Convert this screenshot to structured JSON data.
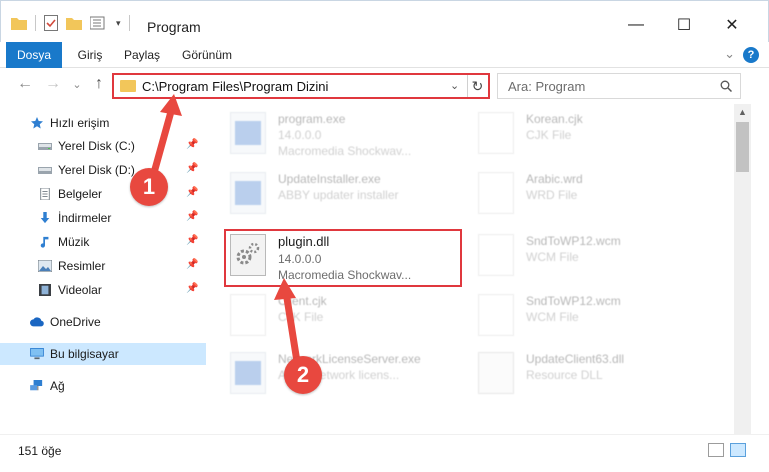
{
  "window": {
    "title": "Program",
    "minimize": "—",
    "maximize": "☐",
    "close": "✕"
  },
  "ribbon": {
    "tabs": [
      "Dosya",
      "Giriş",
      "Paylaş",
      "Görünüm"
    ],
    "chevron": "⌄",
    "help": "?"
  },
  "nav": {
    "back": "←",
    "forward": "→",
    "recent": "⌄",
    "up": "↑",
    "address": "C:\\Program Files\\Program Dizini",
    "dropdown": "⌄",
    "refresh": "↻",
    "search_placeholder": "Ara: Program"
  },
  "sidebar": {
    "items": [
      {
        "label": "Hızlı erişim",
        "icon": "star-icon",
        "pinned": false
      },
      {
        "label": "Yerel Disk (C:)",
        "icon": "drive-icon",
        "pinned": true
      },
      {
        "label": "Yerel Disk (D:)",
        "icon": "drive-icon",
        "pinned": true
      },
      {
        "label": "Belgeler",
        "icon": "documents-icon",
        "pinned": true
      },
      {
        "label": "İndirmeler",
        "icon": "download-icon",
        "pinned": true
      },
      {
        "label": "Müzik",
        "icon": "music-icon",
        "pinned": true
      },
      {
        "label": "Resimler",
        "icon": "pictures-icon",
        "pinned": true
      },
      {
        "label": "Videolar",
        "icon": "videos-icon",
        "pinned": true
      },
      {
        "label": "OneDrive",
        "icon": "cloud-icon",
        "pinned": false
      },
      {
        "label": "Bu bilgisayar",
        "icon": "computer-icon",
        "pinned": false
      },
      {
        "label": "Ağ",
        "icon": "network-icon",
        "pinned": false
      }
    ],
    "pin_glyph": "📌"
  },
  "files": {
    "left": [
      {
        "name": "program.exe",
        "line2": "14.0.0.0",
        "line3": "Macromedia Shockwav..."
      },
      {
        "name": "UpdateInstaller.exe",
        "line2": "ABBY updater installer",
        "line3": ""
      },
      {
        "name": "plugin.dll",
        "line2": "14.0.0.0",
        "line3": "Macromedia Shockwav..."
      },
      {
        "name": "Client.cjk",
        "line2": "CJK File",
        "line3": ""
      },
      {
        "name": "NetworkLicenseServer.exe",
        "line2": "ABBY network licens...",
        "line3": ""
      }
    ],
    "right": [
      {
        "name": "Korean.cjk",
        "line2": "CJK File"
      },
      {
        "name": "Arabic.wrd",
        "line2": "WRD File"
      },
      {
        "name": "SndToWP12.wcm",
        "line2": "WCM File"
      },
      {
        "name": "SndToWP12.wcm",
        "line2": "WCM File"
      },
      {
        "name": "UpdateClient63.dll",
        "line2": "Resource DLL"
      }
    ]
  },
  "callouts": {
    "one": "1",
    "two": "2"
  },
  "status": {
    "count": "151 öğe"
  },
  "colors": {
    "accent": "#1979ca",
    "highlight": "#e0383e",
    "callout": "#e8483f",
    "selected": "#cce8ff"
  }
}
